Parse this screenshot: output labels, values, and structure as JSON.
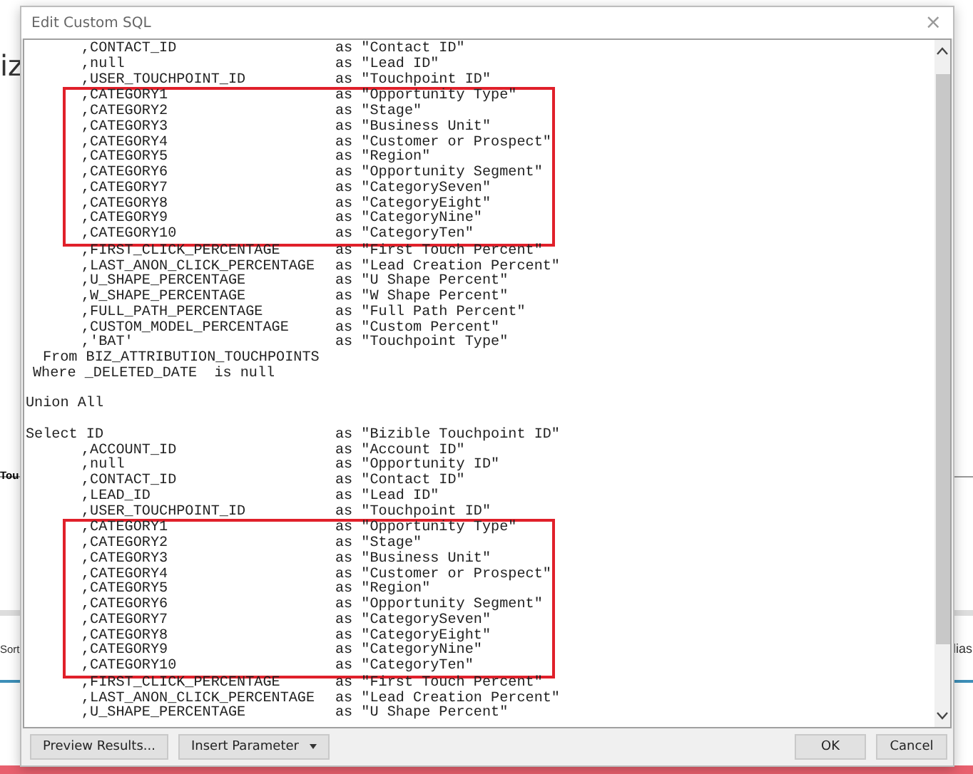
{
  "background": {
    "fragments": [
      {
        "text": "iz",
        "kind": "heading"
      },
      {
        "text": "Tou",
        "kind": "tab"
      },
      {
        "text": "Sort",
        "kind": "label"
      },
      {
        "text": "lias",
        "kind": "label-right"
      }
    ]
  },
  "dialog": {
    "title": "Edit Custom SQL",
    "close": "×",
    "lines": [
      {
        "kind": "column",
        "code": ",CONTACT_ID",
        "alias": "as \"Contact ID\"",
        "boxed": false
      },
      {
        "kind": "column",
        "code": ",null",
        "alias": "as \"Lead ID\"",
        "boxed": false
      },
      {
        "kind": "column",
        "code": ",USER_TOUCHPOINT_ID",
        "alias": "as \"Touchpoint ID\"",
        "boxed": false
      },
      {
        "kind": "column",
        "code": ",CATEGORY1",
        "alias": "as \"Opportunity Type\"",
        "boxed": true
      },
      {
        "kind": "column",
        "code": ",CATEGORY2",
        "alias": "as \"Stage\"",
        "boxed": true
      },
      {
        "kind": "column",
        "code": ",CATEGORY3",
        "alias": "as \"Business Unit\"",
        "boxed": true
      },
      {
        "kind": "column",
        "code": ",CATEGORY4",
        "alias": "as \"Customer or Prospect\"",
        "boxed": true
      },
      {
        "kind": "column",
        "code": ",CATEGORY5",
        "alias": "as \"Region\"",
        "boxed": true
      },
      {
        "kind": "column",
        "code": ",CATEGORY6",
        "alias": "as \"Opportunity Segment\"",
        "boxed": true
      },
      {
        "kind": "column",
        "code": ",CATEGORY7",
        "alias": "as \"CategorySeven\"",
        "boxed": true
      },
      {
        "kind": "column",
        "code": ",CATEGORY8",
        "alias": "as \"CategoryEight\"",
        "boxed": true
      },
      {
        "kind": "column",
        "code": ",CATEGORY9",
        "alias": "as \"CategoryNine\"",
        "boxed": true
      },
      {
        "kind": "column",
        "code": ",CATEGORY10",
        "alias": "as \"CategoryTen\"",
        "boxed": true
      },
      {
        "kind": "column",
        "code": ",FIRST_CLICK_PERCENTAGE",
        "alias": "as \"First Touch Percent\"",
        "boxed": false
      },
      {
        "kind": "column",
        "code": ",LAST_ANON_CLICK_PERCENTAGE",
        "alias": "as \"Lead Creation Percent\"",
        "boxed": false
      },
      {
        "kind": "column",
        "code": ",U_SHAPE_PERCENTAGE",
        "alias": "as \"U Shape Percent\"",
        "boxed": false
      },
      {
        "kind": "column",
        "code": ",W_SHAPE_PERCENTAGE",
        "alias": "as \"W Shape Percent\"",
        "boxed": false
      },
      {
        "kind": "column",
        "code": ",FULL_PATH_PERCENTAGE",
        "alias": "as \"Full Path Percent\"",
        "boxed": false
      },
      {
        "kind": "column",
        "code": ",CUSTOM_MODEL_PERCENTAGE",
        "alias": "as \"Custom Percent\"",
        "boxed": false
      },
      {
        "kind": "column",
        "code": ",'BAT'",
        "alias": "as \"Touchpoint Type\"",
        "boxed": false
      },
      {
        "kind": "from",
        "code": "From BIZ_ATTRIBUTION_TOUCHPOINTS",
        "boxed": false
      },
      {
        "kind": "where",
        "code": "Where _DELETED_DATE  is null",
        "boxed": false
      },
      {
        "kind": "blank",
        "boxed": false
      },
      {
        "kind": "keyword",
        "code": "Union All",
        "boxed": false
      },
      {
        "kind": "blank",
        "boxed": false
      },
      {
        "kind": "keyword",
        "code": "Select ID",
        "alias": "as \"Bizible Touchpoint ID\"",
        "boxed": false
      },
      {
        "kind": "column",
        "code": ",ACCOUNT_ID",
        "alias": "as \"Account ID\"",
        "boxed": false
      },
      {
        "kind": "column",
        "code": ",null",
        "alias": "as \"Opportunity ID\"",
        "boxed": false
      },
      {
        "kind": "column",
        "code": ",CONTACT_ID",
        "alias": "as \"Contact ID\"",
        "boxed": false
      },
      {
        "kind": "column",
        "code": ",LEAD_ID",
        "alias": "as \"Lead ID\"",
        "boxed": false
      },
      {
        "kind": "column",
        "code": ",USER_TOUCHPOINT_ID",
        "alias": "as \"Touchpoint ID\"",
        "boxed": false
      },
      {
        "kind": "column",
        "code": ",CATEGORY1",
        "alias": "as \"Opportunity Type\"",
        "boxed": true
      },
      {
        "kind": "column",
        "code": ",CATEGORY2",
        "alias": "as \"Stage\"",
        "boxed": true
      },
      {
        "kind": "column",
        "code": ",CATEGORY3",
        "alias": "as \"Business Unit\"",
        "boxed": true
      },
      {
        "kind": "column",
        "code": ",CATEGORY4",
        "alias": "as \"Customer or Prospect\"",
        "boxed": true
      },
      {
        "kind": "column",
        "code": ",CATEGORY5",
        "alias": "as \"Region\"",
        "boxed": true
      },
      {
        "kind": "column",
        "code": ",CATEGORY6",
        "alias": "as \"Opportunity Segment\"",
        "boxed": true
      },
      {
        "kind": "column",
        "code": ",CATEGORY7",
        "alias": "as \"CategorySeven\"",
        "boxed": true
      },
      {
        "kind": "column",
        "code": ",CATEGORY8",
        "alias": "as \"CategoryEight\"",
        "boxed": true
      },
      {
        "kind": "column",
        "code": ",CATEGORY9",
        "alias": "as \"CategoryNine\"",
        "boxed": true
      },
      {
        "kind": "column",
        "code": ",CATEGORY10",
        "alias": "as \"CategoryTen\"",
        "boxed": true
      },
      {
        "kind": "column",
        "code": ",FIRST_CLICK_PERCENTAGE",
        "alias": "as \"First Touch Percent\"",
        "boxed": false
      },
      {
        "kind": "column",
        "code": ",LAST_ANON_CLICK_PERCENTAGE",
        "alias": "as \"Lead Creation Percent\"",
        "boxed": false
      },
      {
        "kind": "column",
        "code": ",U_SHAPE_PERCENTAGE",
        "alias": "as \"U Shape Percent\"",
        "boxed": false
      }
    ],
    "buttons": [
      {
        "label": "Preview Results...",
        "kind": "plain"
      },
      {
        "label": "Insert Parameter",
        "kind": "menu"
      },
      {
        "label": "OK",
        "kind": "right"
      },
      {
        "label": "Cancel",
        "kind": "right"
      }
    ]
  }
}
